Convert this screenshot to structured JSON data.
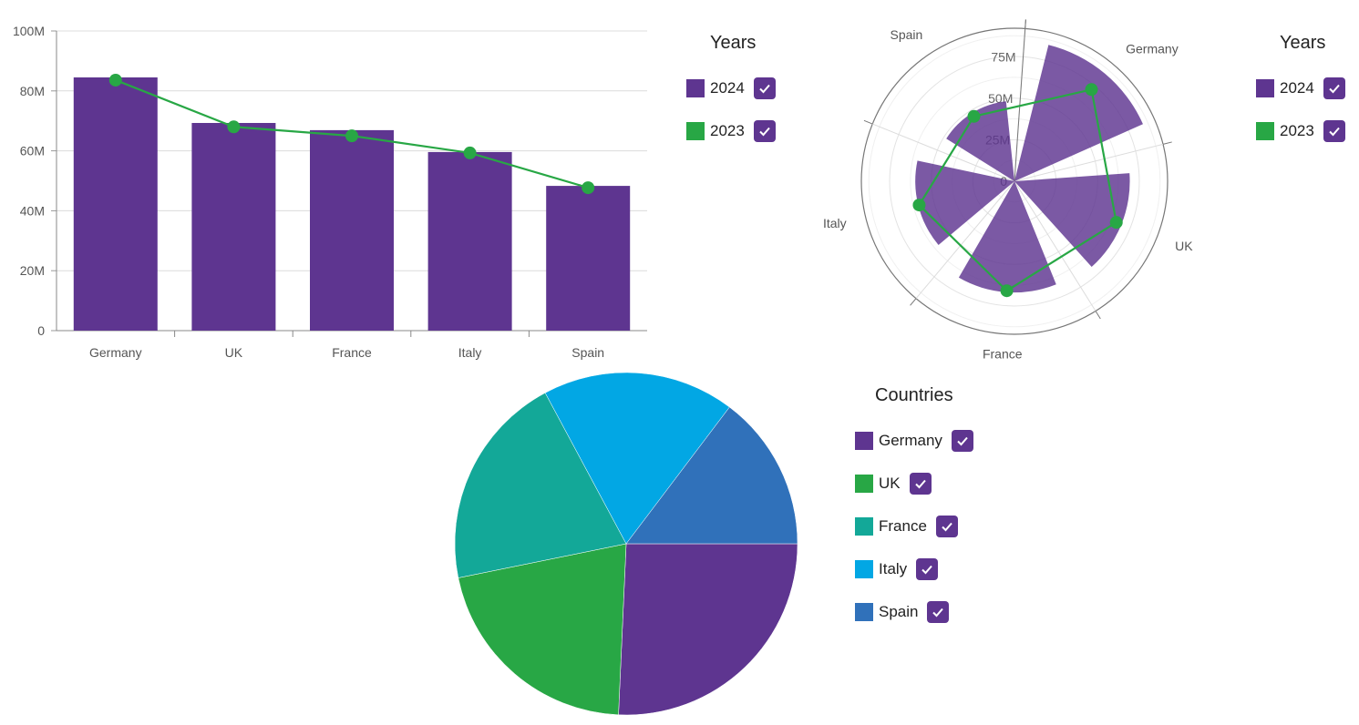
{
  "colors": {
    "primary": "#5e3590",
    "secondary": "#28a745",
    "teal": "#13a898",
    "sky": "#02a7e4",
    "blue": "#3071ba",
    "checkbox": "#5e3590"
  },
  "chart_data": [
    {
      "type": "bar",
      "title": "",
      "categories": [
        "Germany",
        "UK",
        "France",
        "Italy",
        "Spain"
      ],
      "series": [
        {
          "name": "2024",
          "kind": "bar",
          "values": [
            84.5,
            69.3,
            66.9,
            59.6,
            48.3
          ]
        },
        {
          "name": "2023",
          "kind": "line",
          "values": [
            83.6,
            68.0,
            65.0,
            59.3,
            47.7
          ]
        }
      ],
      "ylim": [
        0,
        100
      ],
      "yticks": [
        "0",
        "20M",
        "40M",
        "60M",
        "80M",
        "100M"
      ],
      "grid": true,
      "legend": {
        "title": "Years",
        "position": "right",
        "items": [
          "2024",
          "2023"
        ]
      }
    },
    {
      "type": "polar",
      "title": "",
      "categories": [
        "Germany",
        "UK",
        "France",
        "Italy",
        "Spain"
      ],
      "series": [
        {
          "name": "2024",
          "kind": "radial-bar",
          "values": [
            84.5,
            69.3,
            66.9,
            59.6,
            48.3
          ]
        },
        {
          "name": "2023",
          "kind": "line",
          "values": [
            72.0,
            66.0,
            66.0,
            59.0,
            46.0
          ]
        }
      ],
      "rlim": [
        0,
        92
      ],
      "rticks": [
        "0",
        "25M",
        "50M",
        "75M"
      ],
      "legend": {
        "title": "Years",
        "position": "right",
        "items": [
          "2024",
          "2023"
        ]
      }
    },
    {
      "type": "pie",
      "title": "",
      "categories": [
        "Germany",
        "UK",
        "France",
        "Italy",
        "Spain"
      ],
      "values": [
        84.5,
        69.3,
        66.9,
        59.6,
        48.3
      ],
      "legend": {
        "title": "Countries",
        "position": "right",
        "items": [
          "Germany",
          "UK",
          "France",
          "Italy",
          "Spain"
        ]
      }
    }
  ],
  "legends": {
    "bar": {
      "title": "Years",
      "items": [
        {
          "label": "2024",
          "checked": true
        },
        {
          "label": "2023",
          "checked": true
        }
      ]
    },
    "polar": {
      "title": "Years",
      "items": [
        {
          "label": "2024",
          "checked": true
        },
        {
          "label": "2023",
          "checked": true
        }
      ]
    },
    "pie": {
      "title": "Countries",
      "items": [
        {
          "label": "Germany",
          "checked": true
        },
        {
          "label": "UK",
          "checked": true
        },
        {
          "label": "France",
          "checked": true
        },
        {
          "label": "Italy",
          "checked": true
        },
        {
          "label": "Spain",
          "checked": true
        }
      ]
    }
  }
}
